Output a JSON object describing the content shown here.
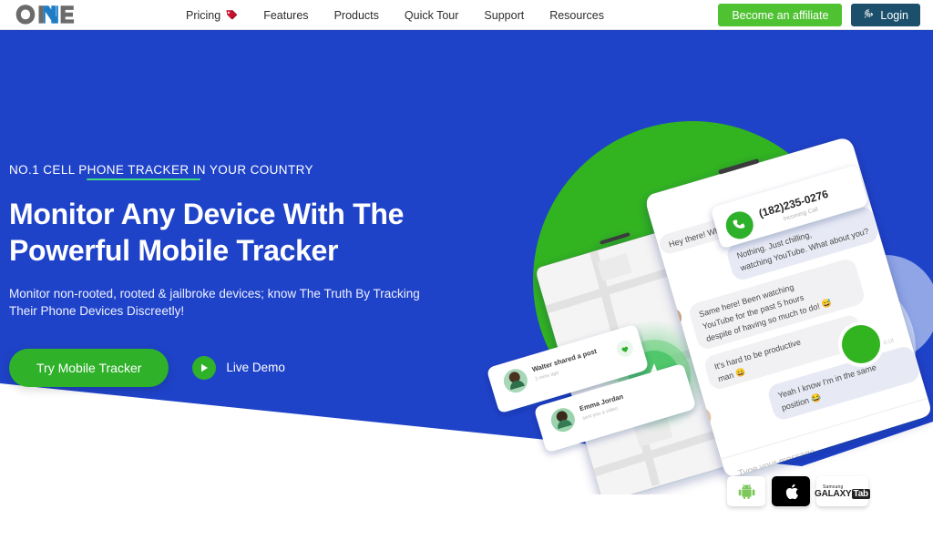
{
  "brand": {
    "name": "ONE",
    "logo_icon": "one-logo"
  },
  "nav": {
    "items": [
      {
        "label": "Pricing",
        "icon": "price-tag-icon"
      },
      {
        "label": "Features",
        "icon": ""
      },
      {
        "label": "Products",
        "icon": ""
      },
      {
        "label": "Quick Tour",
        "icon": ""
      },
      {
        "label": "Support",
        "icon": ""
      },
      {
        "label": "Resources",
        "icon": ""
      }
    ]
  },
  "header_actions": {
    "affiliate_label": "Become an affiliate",
    "login_label": "Login",
    "login_icon": "fingerprint-icon"
  },
  "hero": {
    "eyebrow": "NO.1 CELL PHONE TRACKER IN YOUR COUNTRY",
    "headline_line1": "Monitor Any Device With The",
    "headline_line2": "Powerful Mobile Tracker",
    "subcopy_line1": "Monitor non-rooted, rooted & jailbroke devices; know The Truth By Tracking",
    "subcopy_line2": "Their Phone Devices Discreetly!",
    "primary_cta": "Try Mobile Tracker",
    "demo_label": "Live Demo",
    "demo_icon": "play-icon"
  },
  "artwork": {
    "caller_number": "(182)235-0276",
    "caller_sub": "Incoming Call",
    "call_icon": "phone-icon",
    "messages": [
      {
        "side": "left",
        "text": "Hey there! What's up?"
      },
      {
        "side": "right",
        "text": "Nothing. Just chilling, watching YouTube. What about you?"
      },
      {
        "side": "left",
        "text": "Same here! Been watching YouTube for the past 5 hours despite of having so much to do! 😅"
      },
      {
        "side": "left",
        "text": "It's hard to be productive man 😄"
      },
      {
        "side": "right",
        "text": "Yeah I know I'm in the same position 😂"
      }
    ],
    "composer_placeholder": "Type your message..",
    "notifications": [
      {
        "title": "Walter shared a post",
        "sub": "2 mins ago",
        "icon": "heart-icon"
      },
      {
        "title": "Emma Jordan",
        "sub": "sent you a video",
        "icon": ""
      }
    ],
    "map_icon": "navigation-arrow-icon"
  },
  "badges": [
    {
      "name": "Android",
      "icon": "android-icon"
    },
    {
      "name": "Apple",
      "icon": "apple-icon"
    },
    {
      "name": "Samsung Galaxy Tab",
      "icon": "samsung-galaxy-tab-logo",
      "samsung_top": "Samsung",
      "samsung_main_1": "GALAXY",
      "samsung_main_2": "Tab"
    }
  ],
  "colors": {
    "hero_blue": "#1f43c8",
    "accent_green": "#2fb12a",
    "nav_green": "#4fc232",
    "login_navy": "#1b4f6b",
    "tag_red": "#c4122f",
    "underline_green": "#3ddc84"
  }
}
